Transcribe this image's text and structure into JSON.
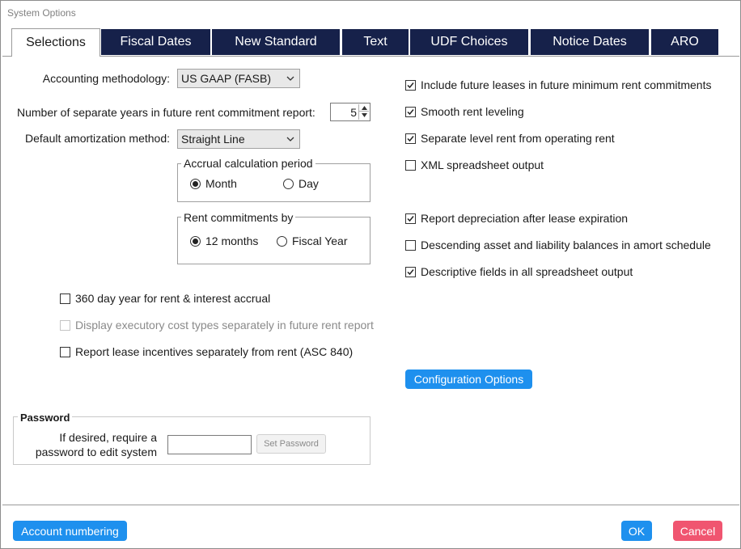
{
  "window": {
    "title": "System Options"
  },
  "tabs": [
    {
      "label": "Selections",
      "active": true
    },
    {
      "label": "Fiscal Dates",
      "active": false
    },
    {
      "label": "New Standard",
      "active": false
    },
    {
      "label": "Text",
      "active": false
    },
    {
      "label": "UDF Choices",
      "active": false
    },
    {
      "label": "Notice Dates",
      "active": false
    },
    {
      "label": "ARO",
      "active": false
    }
  ],
  "left": {
    "accounting_label": "Accounting methodology:",
    "accounting_value": "US GAAP (FASB)",
    "years_label": "Number of separate years in future rent commitment report:",
    "years_value": "5",
    "amort_label": "Default amortization method:",
    "amort_value": "Straight Line",
    "accrual_group": {
      "title": "Accrual calculation period",
      "options": [
        {
          "label": "Month",
          "selected": true
        },
        {
          "label": "Day",
          "selected": false
        }
      ]
    },
    "rent_group": {
      "title": "Rent commitments by",
      "options": [
        {
          "label": "12 months",
          "selected": true
        },
        {
          "label": "Fiscal Year",
          "selected": false
        }
      ]
    },
    "checkboxes": [
      {
        "label": "360 day year for rent & interest accrual",
        "checked": false,
        "disabled": false
      },
      {
        "label": "Display executory cost types separately in future rent report",
        "checked": false,
        "disabled": true
      },
      {
        "label": "Report lease incentives separately from rent (ASC 840)",
        "checked": false,
        "disabled": false
      }
    ]
  },
  "right": {
    "checkboxes": [
      {
        "label": "Include future leases in future minimum rent commitments",
        "checked": true
      },
      {
        "label": "Smooth rent leveling",
        "checked": true
      },
      {
        "label": "Separate level rent from operating rent",
        "checked": true
      },
      {
        "label": "XML spreadsheet output",
        "checked": false
      },
      {
        "label": "Report depreciation after lease expiration",
        "checked": true
      },
      {
        "label": "Descending asset and liability balances in amort schedule",
        "checked": false
      },
      {
        "label": "Descriptive fields in all spreadsheet output",
        "checked": true
      }
    ],
    "config_button": "Configuration Options"
  },
  "password": {
    "title": "Password",
    "desc_line1": "If desired, require a",
    "desc_line2": "password to edit system",
    "input_value": "",
    "set_button": "Set Password"
  },
  "footer": {
    "account_button": "Account numbering",
    "ok_button": "OK",
    "cancel_button": "Cancel"
  },
  "colors": {
    "tab_bg": "#16214a",
    "accent_blue": "#1e90ee",
    "cancel_red": "#f05570"
  }
}
